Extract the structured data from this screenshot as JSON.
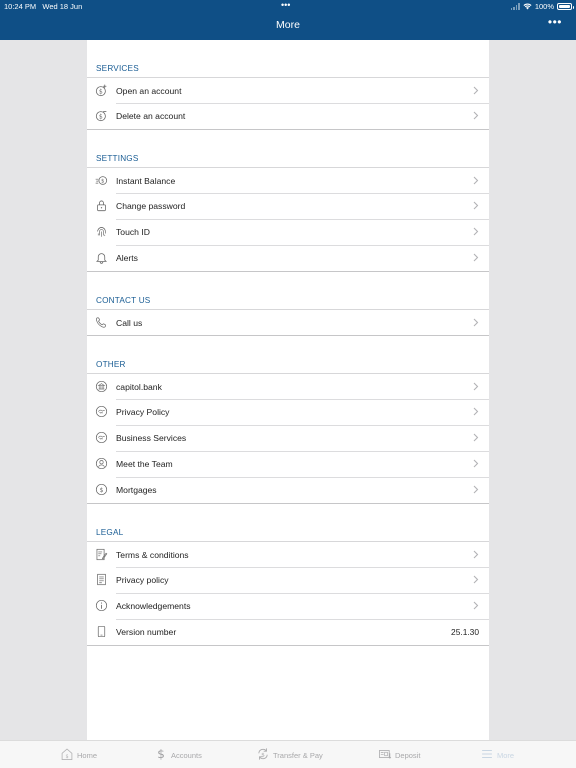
{
  "status_bar": {
    "time": "10:24 PM",
    "date": "Wed 18 Jun",
    "battery": "100%",
    "battery_level": 1.0
  },
  "nav": {
    "title": "More",
    "more_glyph": "•••"
  },
  "colors": {
    "header": "#0f4f86",
    "section_text": "#1a5d94",
    "background": "#e5e5e7"
  },
  "sections": [
    {
      "title": "SERVICES",
      "rows": [
        {
          "label": "Open an account",
          "icon": "dollar-add-icon"
        },
        {
          "label": "Delete an account",
          "icon": "dollar-remove-icon"
        }
      ]
    },
    {
      "title": "SETTINGS",
      "rows": [
        {
          "label": "Instant Balance",
          "icon": "instant-balance-icon"
        },
        {
          "label": "Change password",
          "icon": "lock-icon"
        },
        {
          "label": "Touch ID",
          "icon": "fingerprint-icon"
        },
        {
          "label": "Alerts",
          "icon": "bell-icon"
        }
      ]
    },
    {
      "title": "CONTACT US",
      "rows": [
        {
          "label": "Call us",
          "icon": "phone-icon"
        }
      ]
    },
    {
      "title": "OTHER",
      "rows": [
        {
          "label": "capitol.bank",
          "icon": "bank-icon"
        },
        {
          "label": "Privacy Policy",
          "icon": "handshake-icon"
        },
        {
          "label": "Business Services",
          "icon": "handshake-icon"
        },
        {
          "label": "Meet the Team",
          "icon": "person-icon"
        },
        {
          "label": "Mortgages",
          "icon": "dollar-circle-icon"
        }
      ]
    },
    {
      "title": "LEGAL",
      "rows": [
        {
          "label": "Terms & conditions",
          "icon": "document-pen-icon"
        },
        {
          "label": "Privacy policy",
          "icon": "document-icon"
        },
        {
          "label": "Acknowledgements",
          "icon": "info-icon"
        },
        {
          "label": "Version number",
          "icon": "phone-device-icon",
          "value": "25.1.30"
        }
      ]
    }
  ],
  "tabs": [
    {
      "label": "Home",
      "icon": "home-icon",
      "active": false
    },
    {
      "label": "Accounts",
      "icon": "dollar-icon",
      "active": false
    },
    {
      "label": "Transfer & Pay",
      "icon": "transfer-icon",
      "active": false
    },
    {
      "label": "Deposit",
      "icon": "deposit-icon",
      "active": false
    },
    {
      "label": "More",
      "icon": "menu-icon",
      "active": true
    }
  ]
}
